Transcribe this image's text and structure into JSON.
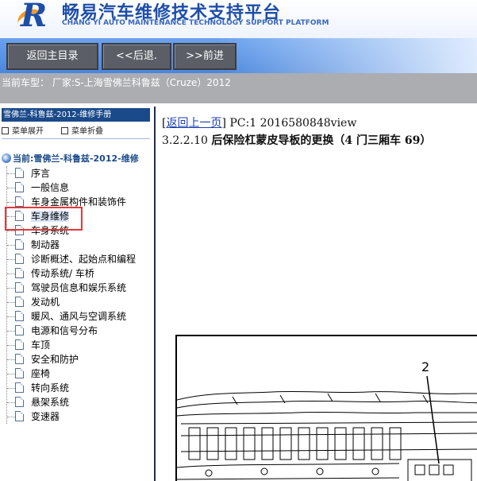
{
  "header": {
    "title": "畅易汽车维修技术支持平台",
    "subtitle": "CHANG YI AUTO MAINTENANCE TECHNOLOGY SUPPORT PLATFORM"
  },
  "toolbar": {
    "home_label": "返回主目录",
    "back_label": "<<后退.",
    "forward_label": ">>前进"
  },
  "vehicle": {
    "current_model": "当前车型：  厂家:S-上海雪佛兰科鲁兹（Cruze）2012"
  },
  "sidebar": {
    "header": "雪佛兰-科鲁兹-2012-维修手册",
    "expand_label": "菜单展开",
    "collapse_label": "菜单折叠",
    "root_label": "当前:雪佛兰-科鲁兹-2012-维修",
    "items": [
      {
        "label": "序言"
      },
      {
        "label": "一般信息"
      },
      {
        "label": "车身金属构件和装饰件"
      },
      {
        "label": "车身维修"
      },
      {
        "label": "车身系统"
      },
      {
        "label": "制动器"
      },
      {
        "label": "诊断概述、起始点和编程"
      },
      {
        "label": "传动系统/ 车桥"
      },
      {
        "label": "驾驶员信息和娱乐系统"
      },
      {
        "label": "发动机"
      },
      {
        "label": "暖风、通风与空调系统"
      },
      {
        "label": "电源和信号分布"
      },
      {
        "label": "车顶"
      },
      {
        "label": "安全和防护"
      },
      {
        "label": "座椅"
      },
      {
        "label": "转向系统"
      },
      {
        "label": "悬架系统"
      },
      {
        "label": "变速器"
      }
    ]
  },
  "content": {
    "back_link": "返回上一页",
    "pc_info": "PC:1 2016580848view",
    "section_number": "3.2.2.10",
    "section_title": "后保险杠蒙皮导板的更换（4 门三厢车 69）",
    "figure_callout": "2"
  }
}
